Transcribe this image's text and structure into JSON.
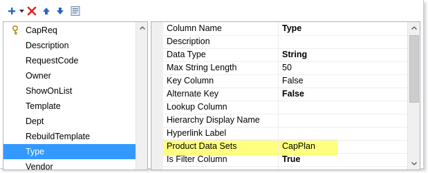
{
  "toolbar": {
    "add_icon": "plus-icon",
    "dropdown_icon": "caret-down-icon",
    "delete_icon": "red-x-icon",
    "up_icon": "arrow-up-icon",
    "down_icon": "arrow-down-icon",
    "properties_icon": "properties-icon"
  },
  "columns_list": {
    "selected_index": 8,
    "items": [
      {
        "label": "CapReq",
        "icon": "key-icon"
      },
      {
        "label": "Description"
      },
      {
        "label": "RequestCode"
      },
      {
        "label": "Owner"
      },
      {
        "label": "ShowOnList"
      },
      {
        "label": "Template"
      },
      {
        "label": "Dept"
      },
      {
        "label": "RebuildTemplate"
      },
      {
        "label": "Type"
      },
      {
        "label": "Vendor"
      }
    ]
  },
  "properties": {
    "rows": [
      {
        "name": "Column Name",
        "value": "Type",
        "bold": true
      },
      {
        "name": "Description",
        "value": ""
      },
      {
        "name": "Data Type",
        "value": "String",
        "bold": true
      },
      {
        "name": "Max String Length",
        "value": "50"
      },
      {
        "name": "Key Column",
        "value": "False"
      },
      {
        "name": "Alternate Key",
        "value": "False",
        "bold": true
      },
      {
        "name": "Lookup Column",
        "value": ""
      },
      {
        "name": "Hierarchy Display Name",
        "value": ""
      },
      {
        "name": "Hyperlink Label",
        "value": ""
      },
      {
        "name": "Product Data Sets",
        "value": "CapPlan"
      },
      {
        "name": "Is Filter Column",
        "value": "True",
        "bold": true
      }
    ]
  },
  "colors": {
    "selection": "#3399ff",
    "highlight": "#ffff66",
    "delete_red": "#e02020",
    "arrow_blue": "#2a62c9"
  }
}
